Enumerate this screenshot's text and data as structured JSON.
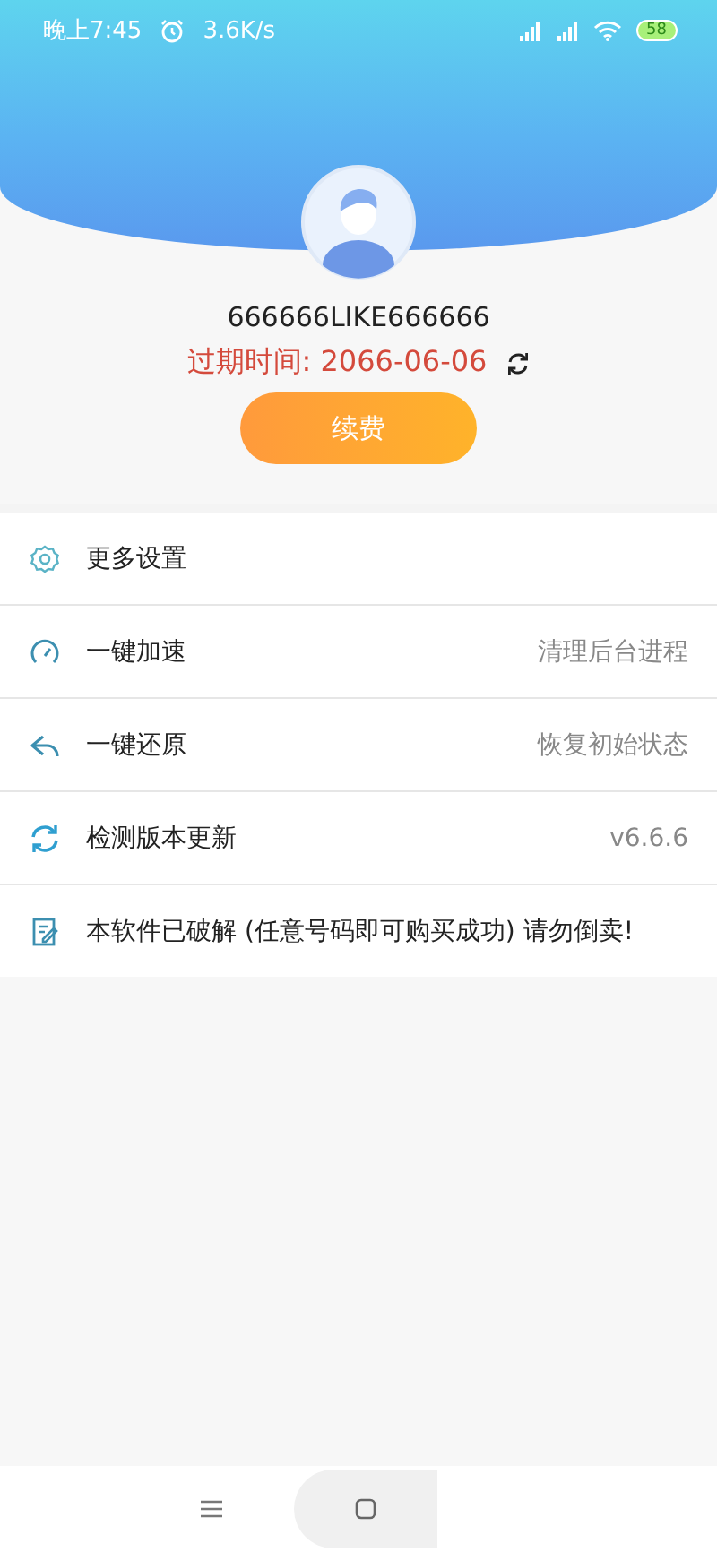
{
  "status_bar": {
    "time": "晚上7:45",
    "speed": "3.6K/s",
    "battery": "58"
  },
  "profile": {
    "username": "666666LIKE666666",
    "expiry": "过期时间: 2066-06-06",
    "renew_button": "续费"
  },
  "menu": [
    {
      "label": "更多设置"
    },
    {
      "label": "一键加速",
      "value": "清理后台进程"
    },
    {
      "label": "一键还原",
      "value": "恢复初始状态"
    },
    {
      "label": "检测版本更新",
      "value": "v6.6.6"
    },
    {
      "label": "本软件已破解 (任意号码即可购买成功) 请勿倒卖!"
    }
  ]
}
